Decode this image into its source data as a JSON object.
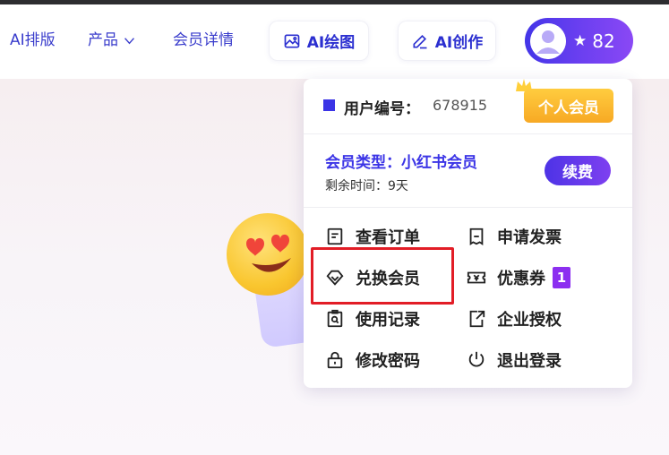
{
  "nav": {
    "ai_layout": "AI排版",
    "product": "产品",
    "member_details": "会员详情",
    "ai_draw": "AI绘图",
    "ai_create": "AI创作"
  },
  "user": {
    "star": "★",
    "points": "82"
  },
  "dropdown": {
    "uid_label": "用户编号：",
    "uid_value": "678915",
    "badge": "个人会员",
    "member_type": "会员类型：小红书会员",
    "remaining": "剩余时间：9天",
    "renew": "续费",
    "menu": {
      "view_orders": "查看订单",
      "invoice": "申请发票",
      "redeem": "兑换会员",
      "coupon": "优惠券",
      "coupon_count": "1",
      "usage": "使用记录",
      "enterprise": "企业授权",
      "password": "修改密码",
      "logout": "退出登录"
    }
  },
  "colors": {
    "accent": "#3b34e6",
    "highlight": "#e21d26",
    "badge_gold": "#f7a924"
  }
}
